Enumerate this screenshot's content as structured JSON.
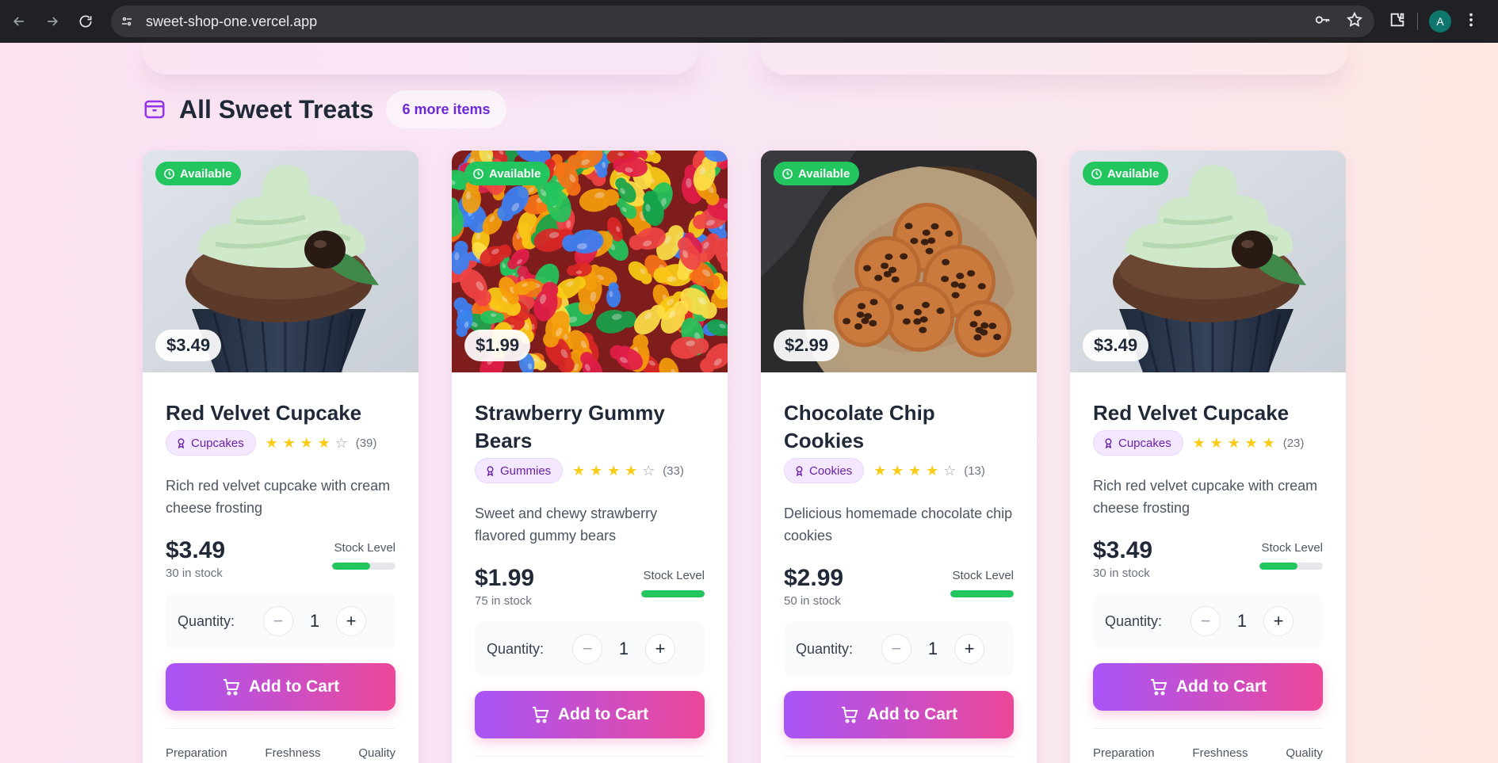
{
  "browser": {
    "url": "sweet-shop-one.vercel.app",
    "profile_initial": "A"
  },
  "section": {
    "title": "All Sweet Treats",
    "more_badge": "6 more items"
  },
  "quantity_label": "Quantity:",
  "add_to_cart_label": "Add to Cart",
  "stock_level_label": "Stock Level",
  "metrics_labels": [
    "Preparation",
    "Freshness",
    "Quality"
  ],
  "colors": {
    "accent_purple": "#a855f7",
    "accent_pink": "#ec4899",
    "available_green": "#22c55e",
    "star_yellow": "#facc15"
  },
  "products": [
    {
      "name": "Red Velvet Cupcake",
      "status": "Available",
      "price": "$3.49",
      "category": "Cupcakes",
      "rating": 4,
      "review_count": "(39)",
      "description": "Rich red velvet cupcake with cream cheese frosting",
      "stock_text": "30 in stock",
      "stock_fraction": 0.6,
      "quantity": "1",
      "image": "cupcake"
    },
    {
      "name": "Strawberry Gummy Bears",
      "status": "Available",
      "price": "$1.99",
      "category": "Gummies",
      "rating": 4,
      "review_count": "(33)",
      "description": "Sweet and chewy strawberry flavored gummy bears",
      "stock_text": "75 in stock",
      "stock_fraction": 1.0,
      "quantity": "1",
      "image": "gummies"
    },
    {
      "name": "Chocolate Chip Cookies",
      "status": "Available",
      "price": "$2.99",
      "category": "Cookies",
      "rating": 4,
      "review_count": "(13)",
      "description": "Delicious homemade chocolate chip cookies",
      "stock_text": "50 in stock",
      "stock_fraction": 1.0,
      "quantity": "1",
      "image": "cookies"
    },
    {
      "name": "Red Velvet Cupcake",
      "status": "Available",
      "price": "$3.49",
      "category": "Cupcakes",
      "rating": 5,
      "review_count": "(23)",
      "description": "Rich red velvet cupcake with cream cheese frosting",
      "stock_text": "30 in stock",
      "stock_fraction": 0.6,
      "quantity": "1",
      "image": "cupcake"
    }
  ]
}
